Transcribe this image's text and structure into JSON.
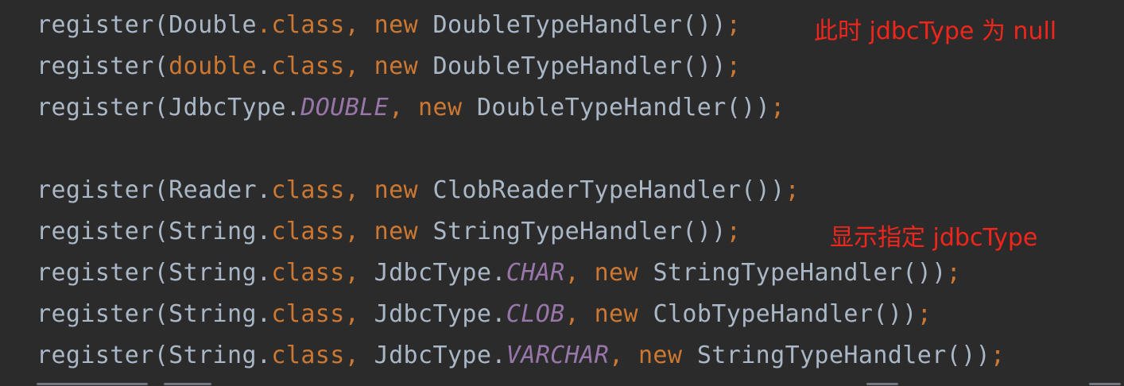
{
  "colors": {
    "background": "#2b2b2b",
    "identifier": "#a9b7c6",
    "keyword": "#cc7832",
    "constant": "#9876aa",
    "annotation": "#f0261c"
  },
  "code": {
    "lines": [
      {
        "tokens": [
          {
            "t": "register(Double",
            "k": "plain"
          },
          {
            "t": ".class",
            "k": "kw"
          },
          {
            "t": ",",
            "k": "kw"
          },
          {
            "t": " new ",
            "k": "kw"
          },
          {
            "t": "DoubleTypeHandler())",
            "k": "plain"
          },
          {
            "t": ";",
            "k": "kw"
          }
        ]
      },
      {
        "tokens": [
          {
            "t": "register(",
            "k": "plain"
          },
          {
            "t": "double",
            "k": "kw"
          },
          {
            "t": ".",
            "k": "plain"
          },
          {
            "t": "class",
            "k": "kw"
          },
          {
            "t": ",",
            "k": "kw"
          },
          {
            "t": " new ",
            "k": "kw"
          },
          {
            "t": "DoubleTypeHandler())",
            "k": "plain"
          },
          {
            "t": ";",
            "k": "kw"
          }
        ]
      },
      {
        "tokens": [
          {
            "t": "register(JdbcType.",
            "k": "plain"
          },
          {
            "t": "DOUBLE",
            "k": "field"
          },
          {
            "t": ",",
            "k": "kw"
          },
          {
            "t": " new ",
            "k": "kw"
          },
          {
            "t": "DoubleTypeHandler())",
            "k": "plain"
          },
          {
            "t": ";",
            "k": "kw"
          }
        ]
      },
      {
        "tokens": []
      },
      {
        "tokens": [
          {
            "t": "register(Reader.",
            "k": "plain"
          },
          {
            "t": "class",
            "k": "kw"
          },
          {
            "t": ",",
            "k": "kw"
          },
          {
            "t": " new ",
            "k": "kw"
          },
          {
            "t": "ClobReaderTypeHandler())",
            "k": "plain"
          },
          {
            "t": ";",
            "k": "kw"
          }
        ]
      },
      {
        "tokens": [
          {
            "t": "register(String.",
            "k": "plain"
          },
          {
            "t": "class",
            "k": "kw"
          },
          {
            "t": ",",
            "k": "kw"
          },
          {
            "t": " new ",
            "k": "kw"
          },
          {
            "t": "StringTypeHandler())",
            "k": "plain"
          },
          {
            "t": ";",
            "k": "kw"
          }
        ]
      },
      {
        "tokens": [
          {
            "t": "register(String.",
            "k": "plain"
          },
          {
            "t": "class",
            "k": "kw"
          },
          {
            "t": ",",
            "k": "kw"
          },
          {
            "t": " JdbcType.",
            "k": "plain"
          },
          {
            "t": "CHAR",
            "k": "field"
          },
          {
            "t": ",",
            "k": "kw"
          },
          {
            "t": " new ",
            "k": "kw"
          },
          {
            "t": "StringTypeHandler())",
            "k": "plain"
          },
          {
            "t": ";",
            "k": "kw"
          }
        ]
      },
      {
        "tokens": [
          {
            "t": "register(String.",
            "k": "plain"
          },
          {
            "t": "class",
            "k": "kw"
          },
          {
            "t": ",",
            "k": "kw"
          },
          {
            "t": " JdbcType.",
            "k": "plain"
          },
          {
            "t": "CLOB",
            "k": "field"
          },
          {
            "t": ",",
            "k": "kw"
          },
          {
            "t": " new ",
            "k": "kw"
          },
          {
            "t": "ClobTypeHandler())",
            "k": "plain"
          },
          {
            "t": ";",
            "k": "kw"
          }
        ]
      },
      {
        "tokens": [
          {
            "t": "register(String.",
            "k": "plain"
          },
          {
            "t": "class",
            "k": "kw"
          },
          {
            "t": ",",
            "k": "kw"
          },
          {
            "t": " JdbcType.",
            "k": "plain"
          },
          {
            "t": "VARCHAR",
            "k": "field"
          },
          {
            "t": ",",
            "k": "kw"
          },
          {
            "t": " new ",
            "k": "kw"
          },
          {
            "t": "StringTypeHandler())",
            "k": "plain"
          },
          {
            "t": ";",
            "k": "kw"
          }
        ]
      }
    ]
  },
  "annotations": {
    "note_null": "此时 jdbcType 为 null",
    "note_explicit": "显示指定 jdbcType"
  }
}
